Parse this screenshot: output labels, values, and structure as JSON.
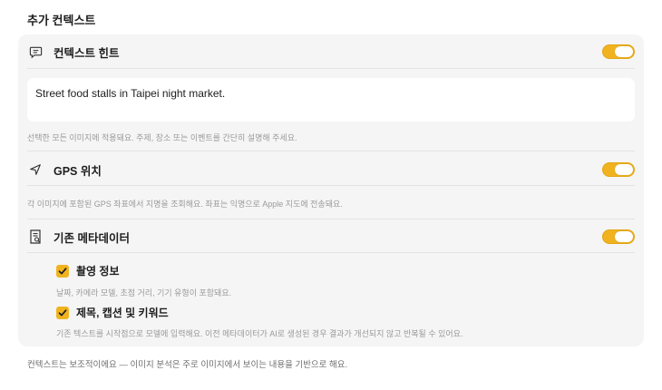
{
  "section": {
    "title": "추가 컨텍스트"
  },
  "context_hint": {
    "label": "컨텍스트 힌트",
    "enabled": true,
    "value": "Street food stalls in Taipei night market.",
    "description": "선택한 모든 이미지에 적용돼요. 주제, 장소 또는 이벤트를 간단히 설명해 주세요.",
    "icon": "speech-bubble-icon"
  },
  "gps": {
    "label": "GPS 위치",
    "enabled": true,
    "description": "각 이미지에 포함된 GPS 좌표에서 지명을 조회해요. 좌표는 익명으로 Apple 지도에 전송돼요.",
    "icon": "location-arrow-icon"
  },
  "metadata": {
    "label": "기존 메타데이터",
    "enabled": true,
    "icon": "document-info-icon",
    "shooting_info": {
      "label": "촬영 정보",
      "checked": true,
      "description": "날짜, 카메라 모델, 초점 거리, 기기 유형이 포함돼요."
    },
    "title_caption": {
      "label": "제목, 캡션 및 키워드",
      "checked": true,
      "description": "기존 텍스트를 시작점으로 모델에 입력해요. 이전 메타데이터가 AI로 생성된 경우 결과가 개선되지 않고 반복될 수 있어요."
    }
  },
  "footer": {
    "text": "컨텍스트는 보조적이에요 — 이미지 분석은 주로 이미지에서 보이는 내용을 기반으로 해요."
  },
  "colors": {
    "accent": "#f0b31f",
    "panel_bg": "#f5f5f5"
  }
}
